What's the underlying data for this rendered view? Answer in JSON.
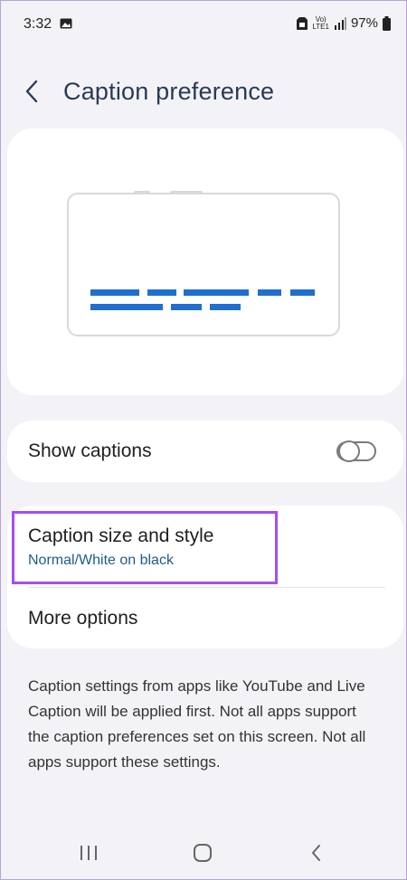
{
  "status_bar": {
    "time": "3:32",
    "volte_top": "Vo)",
    "volte_bottom": "LTE1",
    "battery": "97%"
  },
  "header": {
    "back_icon": "chevron-left-icon",
    "title": "Caption preference"
  },
  "preview": {
    "caption_color": "#1f6fd1"
  },
  "show_captions": {
    "label": "Show captions",
    "enabled": false
  },
  "options": {
    "size_style_label": "Caption size and style",
    "size_style_value": "Normal/White on black",
    "more_label": "More options"
  },
  "description": "Caption settings from apps like YouTube and Live Caption will be applied first. Not all apps support the caption preferences set on this screen. Not all apps support these settings.",
  "nav": {
    "recents_icon": "recents-icon",
    "home_icon": "home-icon",
    "back_icon": "back-icon"
  },
  "highlight_color": "#a64df2"
}
